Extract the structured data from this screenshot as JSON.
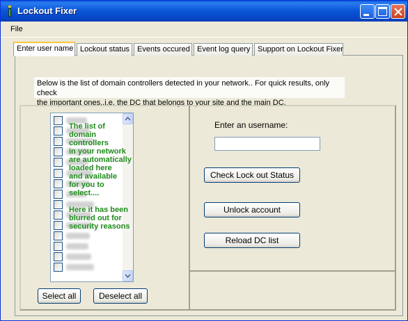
{
  "window": {
    "title": "Lockout Fixer"
  },
  "menu": {
    "file": "File"
  },
  "tabs": [
    {
      "label": "Enter user name",
      "active": true
    },
    {
      "label": "Lockout status",
      "active": false
    },
    {
      "label": "Events occured",
      "active": false
    },
    {
      "label": "Event log query",
      "active": false
    },
    {
      "label": "Support on Lockout Fixer",
      "active": false
    }
  ],
  "intro": {
    "line1": "Below is the list of domain controllers detected in your network.. For quick results, only check",
    "line2": "the important ones..i.e, the DC that belongs to your site and the main DC."
  },
  "dc_list": {
    "count": 15
  },
  "annotation": {
    "lines": [
      "The list of",
      "domain",
      "controllers",
      "in your network",
      " are automatically",
      "loaded here",
      "and available",
      "for you to",
      " select....",
      "Here it has been",
      "blurred out for",
      "security reasons"
    ]
  },
  "buttons": {
    "select_all": "Select all",
    "deselect_all": "Deselect all",
    "check_status": "Check Lock out Status",
    "unlock": "Unlock account",
    "reload": "Reload DC list"
  },
  "username": {
    "label": "Enter an username:",
    "value": ""
  },
  "colors": {
    "annotation": "#1f8b1c",
    "titlebar": "#0b58d9",
    "tab_highlight": "#ffc83c"
  }
}
